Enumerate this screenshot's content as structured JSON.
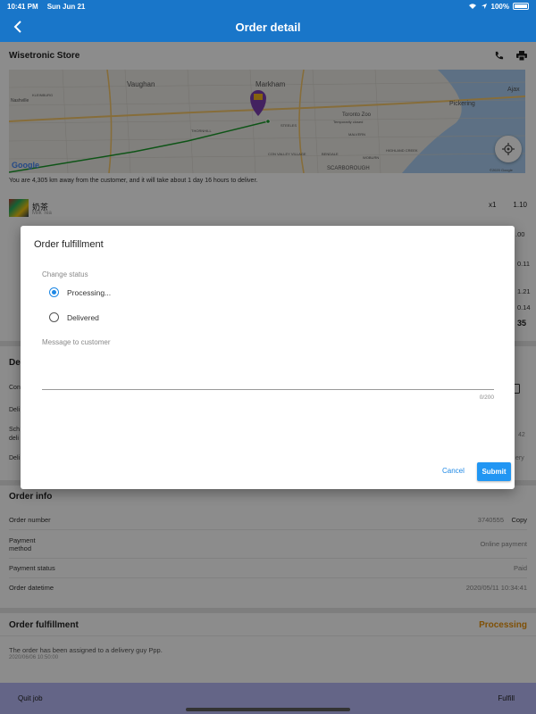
{
  "status_bar": {
    "time": "10:41 PM",
    "date": "Sun Jun 21",
    "battery": "100%"
  },
  "nav": {
    "title": "Order detail"
  },
  "store": {
    "name": "Wisetronic Store"
  },
  "map": {
    "labels": [
      "Vaughan",
      "Markham",
      "Pickering",
      "Ajax",
      "Nashville",
      "KLEINBURG",
      "Toronto Zoo",
      "Temporarily closed",
      "THORNHILL",
      "STEELES",
      "MALVERN",
      "CON VALLEY VILLAGE",
      "SCARBOROUGH",
      "HIGHLAND CREEK",
      "WOBURN",
      "BENDALE"
    ],
    "google": "Google",
    "copyright": "©2020 Google"
  },
  "distance_text": "You are 4,305 km away from the customer, and it will take about 1 day 16 hours to deliver.",
  "item": {
    "name": "奶茶",
    "sub": "Milk Tea",
    "qty": "x1",
    "price": "1.10"
  },
  "partial_values": [
    ".00",
    "0.11",
    "1.21",
    "0.14",
    "35"
  ],
  "delivery_partial": {
    "title": "De",
    "rows": [
      "Con",
      "Deli",
      "Sch",
      "deli",
      "Deli"
    ],
    "right": [
      "42",
      "ery"
    ]
  },
  "order_info": {
    "title": "Order info",
    "rows": [
      {
        "key": "Order number",
        "value": "3740555",
        "action": "Copy"
      },
      {
        "key": "Payment",
        "key2": "method",
        "value": "Online payment"
      },
      {
        "key": "Payment status",
        "value": "Paid"
      },
      {
        "key": "Order datetime",
        "value": "2020/05/11 10:34:41"
      }
    ]
  },
  "fulfillment": {
    "title": "Order fulfillment",
    "status": "Processing",
    "note": "The order has been assigned to a delivery guy Ppp.",
    "note_time": "2020/06/06 10:50:00"
  },
  "bottom": {
    "quit": "Quit job",
    "fulfill": "Fulfill"
  },
  "dialog": {
    "title": "Order fulfillment",
    "change_status_label": "Change status",
    "options": [
      {
        "label": "Processing...",
        "selected": true
      },
      {
        "label": "Delivered",
        "selected": false
      }
    ],
    "message_label": "Message to customer",
    "message_value": "",
    "counter": "0/200",
    "cancel": "Cancel",
    "submit": "Submit"
  },
  "colors": {
    "nav": "#1976c9",
    "accent": "#2196f3",
    "status": "#e8920c",
    "bottom_bar": "#b7b9f6"
  }
}
